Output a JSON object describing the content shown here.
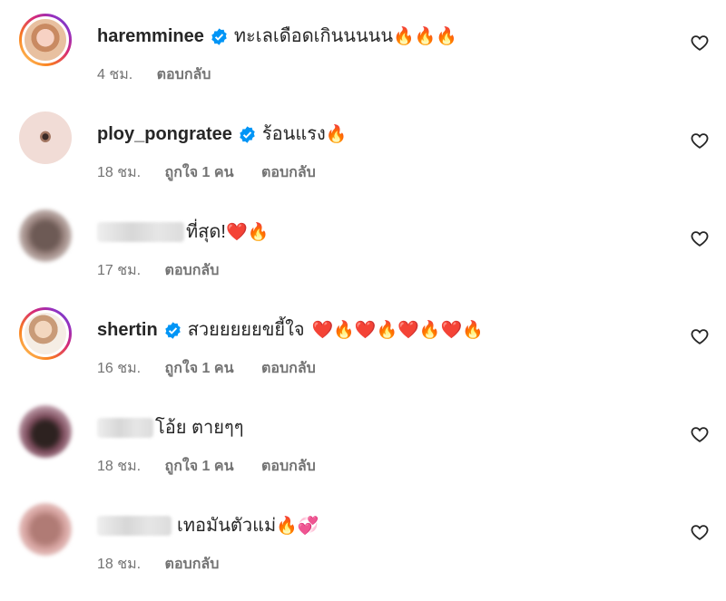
{
  "comments": [
    {
      "username": "haremminee",
      "verified": true,
      "text": "ทะเลเดือดเกินนนนน",
      "emojis": "🔥🔥🔥",
      "time": "4 ชม.",
      "likes": "",
      "reply": "ตอบกลับ"
    },
    {
      "username": "ploy_pongratee",
      "verified": true,
      "text": "ร้อนแรง",
      "emojis": "🔥",
      "time": "18 ชม.",
      "likes": "ถูกใจ 1 คน",
      "reply": "ตอบกลับ"
    },
    {
      "username": "",
      "verified": false,
      "text": "ที่สุด!",
      "emojis": "❤️🔥",
      "time": "17 ชม.",
      "likes": "",
      "reply": "ตอบกลับ"
    },
    {
      "username": "shertin",
      "verified": true,
      "text": "สวยยยยยขยี้ใจ",
      "emojis": "❤️🔥❤️🔥❤️🔥❤️🔥",
      "time": "16 ชม.",
      "likes": "ถูกใจ 1 คน",
      "reply": "ตอบกลับ"
    },
    {
      "username": "",
      "verified": false,
      "text": "โอ้ย ตายๆๆ",
      "emojis": "",
      "time": "18 ชม.",
      "likes": "ถูกใจ 1 คน",
      "reply": "ตอบกลับ"
    },
    {
      "username": "",
      "verified": false,
      "text": "เทอมันตัวแม่",
      "emojis": "🔥💞",
      "time": "18 ชม.",
      "likes": "",
      "reply": "ตอบกลับ"
    }
  ],
  "colors": {
    "verified_blue": "#0095f6",
    "username": "#262626",
    "meta_gray": "#737373"
  },
  "icons": {
    "verified": "verified-badge-icon",
    "like": "heart-outline-icon"
  }
}
